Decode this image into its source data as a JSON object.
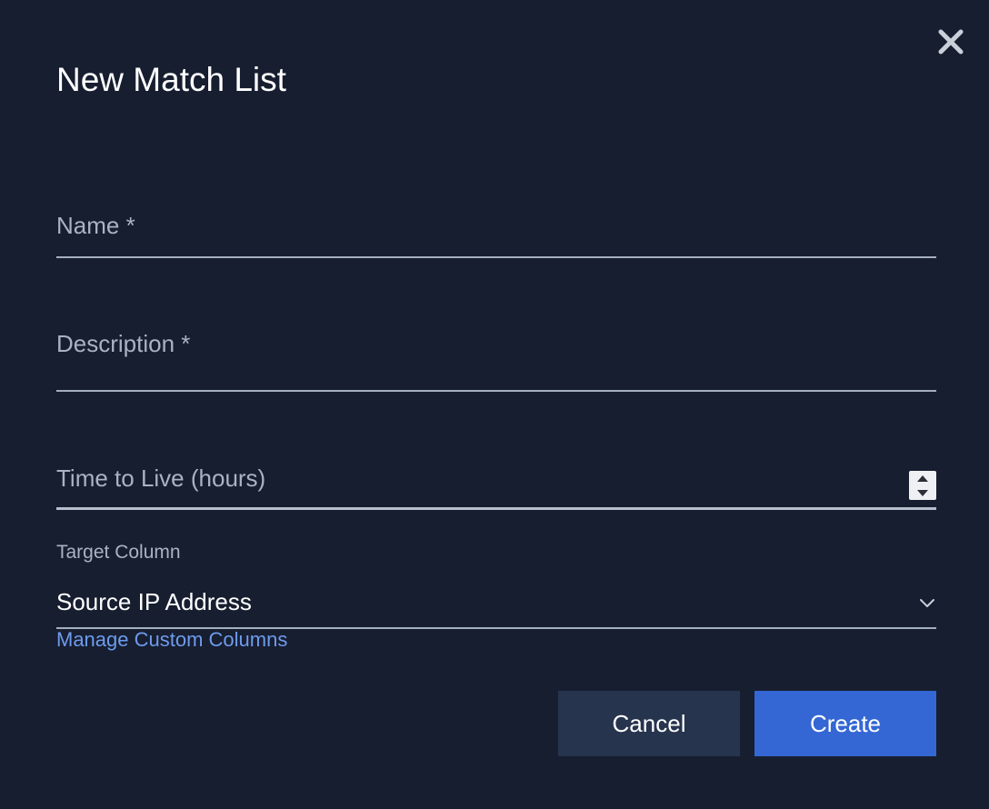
{
  "dialog": {
    "title": "New Match List",
    "close_icon": "close-icon"
  },
  "form": {
    "name": {
      "placeholder": "Name *",
      "value": ""
    },
    "description": {
      "placeholder": "Description *",
      "value": ""
    },
    "ttl": {
      "placeholder": "Time to Live (hours)",
      "value": "",
      "stepper_icon": "stepper-icon"
    },
    "target_column": {
      "label": "Target Column",
      "selected": "Source IP Address",
      "chevron_icon": "chevron-down-icon"
    },
    "manage_link": "Manage Custom Columns"
  },
  "actions": {
    "cancel_label": "Cancel",
    "create_label": "Create"
  },
  "colors": {
    "background": "#171e30",
    "cancel_button": "#27344e",
    "create_button": "#3467d4",
    "link": "#6e9bec"
  }
}
